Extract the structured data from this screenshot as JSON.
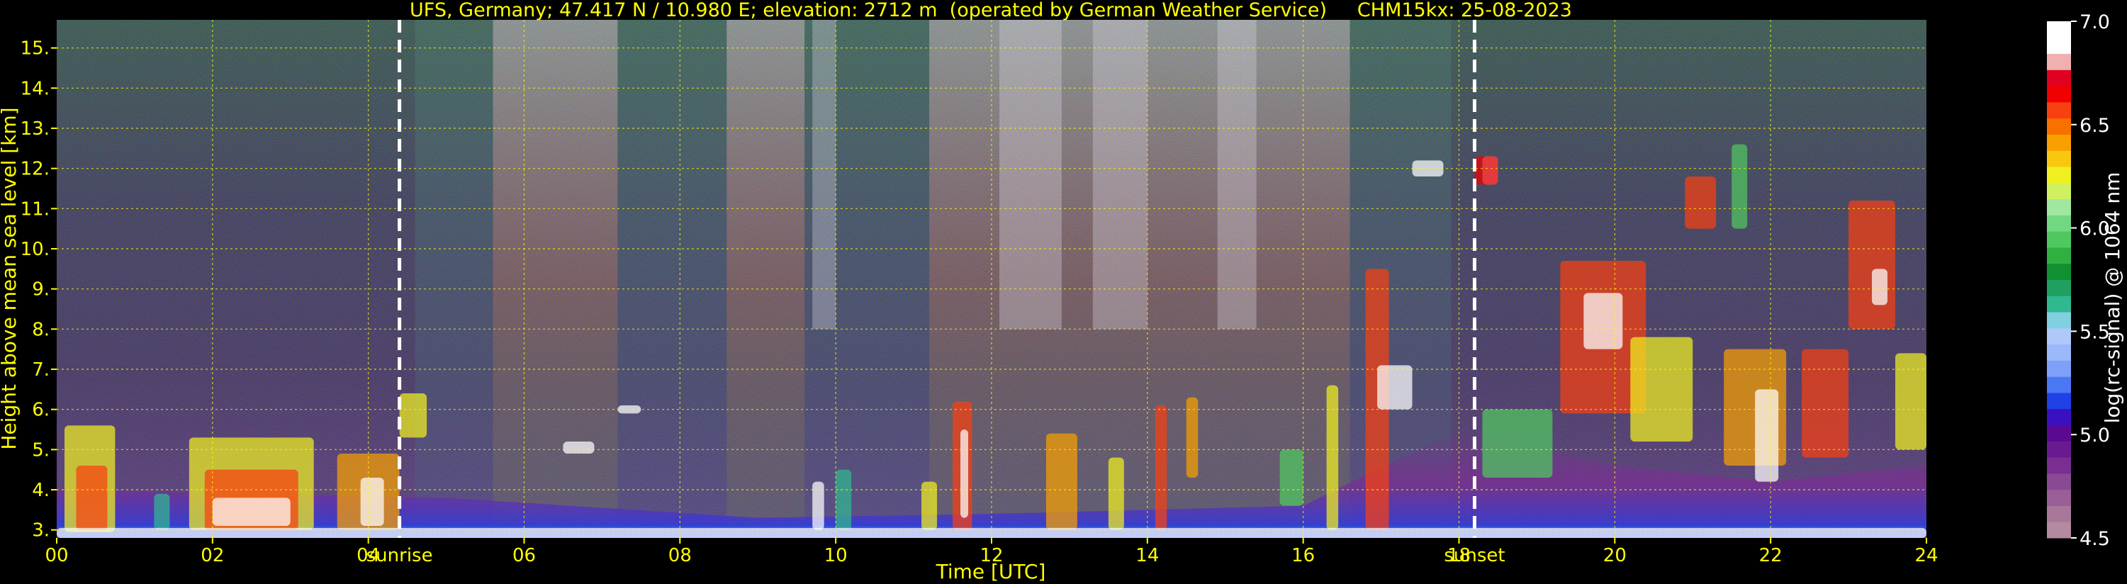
{
  "chart_data": {
    "type": "heatmap",
    "title": "UFS, Germany; 47.417 N / 10.980 E; elevation: 2712 m  (operated by German Weather Service)     CHM15kx: 25-08-2023",
    "xlabel": "Time [UTC]",
    "ylabel": "Height above mean sea level [km]",
    "xlim": [
      0,
      24
    ],
    "ylim": [
      2.8,
      15.7
    ],
    "x_ticks": [
      "00",
      "02",
      "04",
      "06",
      "08",
      "10",
      "12",
      "14",
      "16",
      "18",
      "20",
      "22",
      "24"
    ],
    "y_ticks": [
      "3.",
      "4.",
      "5.",
      "6.",
      "7.",
      "8.",
      "9.",
      "10.",
      "11.",
      "12.",
      "13.",
      "14.",
      "15."
    ],
    "grid": true,
    "markers": [
      {
        "label": "sunrise",
        "x": 4.4
      },
      {
        "label": "sunset",
        "x": 18.2
      }
    ],
    "colorbar": {
      "label": "log(rc-signal) @ 1064 nm",
      "range": [
        4.5,
        7.0
      ],
      "ticks": [
        "4.5",
        "5.0",
        "5.5",
        "6.0",
        "6.5",
        "7.0"
      ],
      "colors": [
        "#b38a9f",
        "#a8789a",
        "#9a5f96",
        "#8a4a93",
        "#7a2e92",
        "#6a1a90",
        "#5a0a90",
        "#3a10c0",
        "#2040e8",
        "#4a78f5",
        "#7ea0f8",
        "#9ab8fa",
        "#b0c8f8",
        "#80d0e0",
        "#30b890",
        "#20a060",
        "#109030",
        "#30b040",
        "#50c860",
        "#70d880",
        "#a0e8a0",
        "#d0f060",
        "#f0f020",
        "#f8c810",
        "#f8a000",
        "#f87000",
        "#f84010",
        "#f00000",
        "#e00020",
        "#f0b0b0",
        "#ffffff",
        "#ffffff"
      ]
    }
  }
}
